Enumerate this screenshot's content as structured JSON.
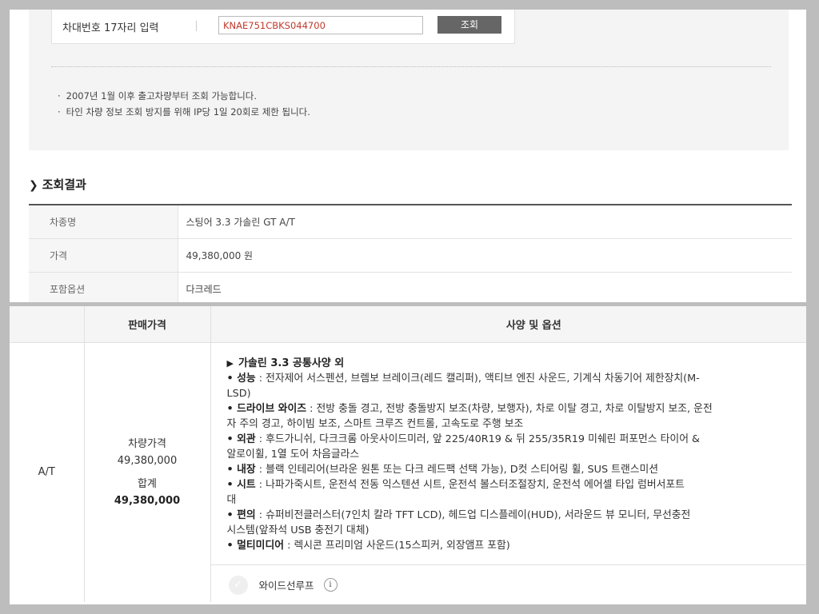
{
  "vin_search": {
    "label": "차대번호 17자리 입력",
    "value": "KNAE751CBKS044700",
    "button_label": "조회"
  },
  "notices": [
    "2007년 1월 이후 출고차량부터 조회 가능합니다.",
    "타인 차량 정보 조회 방지를 위해 IP당 1일 20회로 제한 됩니다."
  ],
  "result": {
    "heading": "조회결과",
    "rows": [
      {
        "label": "차종명",
        "value": "스팅어 3.3 가솔린 GT A/T"
      },
      {
        "label": "가격",
        "value": "49,380,000 원"
      },
      {
        "label": "포함옵션",
        "value": "다크레드"
      }
    ]
  },
  "spec_table": {
    "headers": {
      "trim": "",
      "price": "판매가격",
      "spec": "사양 및 옵션"
    },
    "trim": "A/T",
    "price": {
      "vehicle_label": "차량가격",
      "vehicle_value": "49,380,000",
      "total_label": "합계",
      "total_value": "49,380,000"
    },
    "spec_title": "가솔린 3.3 공통사양 외",
    "spec_lines": [
      {
        "cat": "• 성능",
        "text": " : 전자제어 서스펜션, 브렘보 브레이크(레드 캘리퍼), 액티브 엔진 사운드, 기계식 차동기어 제한장치(M-"
      },
      {
        "cat": "",
        "text": "LSD)"
      },
      {
        "cat": "• 드라이브 와이즈",
        "text": " : 전방 충돌 경고, 전방 충돌방지 보조(차량, 보행자), 차로 이탈 경고, 차로 이탈방지 보조, 운전"
      },
      {
        "cat": "",
        "text": "자 주의 경고, 하이빔 보조, 스마트 크루즈 컨트롤, 고속도로 주행 보조"
      },
      {
        "cat": "• 외관",
        "text": " : 후드가니쉬, 다크크롬 아웃사이드미러, 앞 225/40R19 & 뒤 255/35R19 미쉐린 퍼포먼스 타이어 &"
      },
      {
        "cat": "",
        "text": "알로이휠, 1열 도어 차음글라스"
      },
      {
        "cat": "• 내장",
        "text": " : 블랙 인테리어(브라운 원톤 또는 다크 레드팩 선택 가능), D컷 스티어링 휠, SUS 트랜스미션"
      },
      {
        "cat": "• 시트",
        "text": " : 나파가죽시트, 운전석 전동 익스텐션 시트, 운전석 볼스터조절장치, 운전석 에어셀 타입 럼버서포트"
      },
      {
        "cat": "",
        "text": "대"
      },
      {
        "cat": "• 편의",
        "text": " : 슈퍼비전클러스터(7인치 칼라 TFT LCD), 헤드업 디스플레이(HUD), 서라운드 뷰 모니터, 무선충전"
      },
      {
        "cat": "",
        "text": "시스템(앞좌석 USB 충전기 대체)"
      },
      {
        "cat": "• 멀티미디어",
        "text": " : 렉시콘 프리미엄 사운드(15스피커, 외장앰프 포함)"
      }
    ],
    "option": {
      "label": "와이드선루프",
      "info": "i"
    }
  }
}
